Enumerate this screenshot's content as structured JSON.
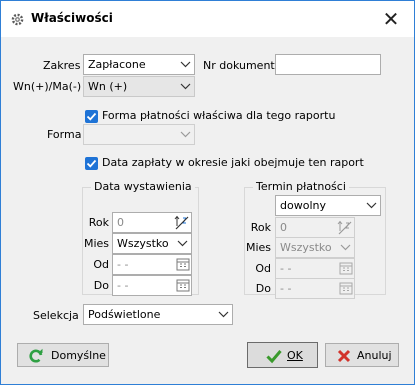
{
  "window": {
    "title": "Właściwości",
    "close_glyph": "✕"
  },
  "top": {
    "zakres_label": "Zakres",
    "zakres_value": "Zapłacone",
    "nr_dokumentu_label": "Nr dokumentu",
    "nr_dokumentu_value": "",
    "wn_ma_label": "Wn(+)/Ma(-)",
    "wn_ma_value": "Wn (+)"
  },
  "forma_platnosci": {
    "checkbox_label": "Forma płatności właściwa dla tego raportu",
    "checked": true,
    "forma_label": "Forma",
    "forma_value": ""
  },
  "data_zaplaty": {
    "checkbox_label": "Data zapłaty w okresie jaki obejmuje ten raport",
    "checked": true
  },
  "data_wystawienia": {
    "title": "Data wystawienia",
    "rok_label": "Rok",
    "rok_value": "0",
    "mies_label": "Mies",
    "mies_value": "Wszystko",
    "od_label": "Od",
    "od_value": "-  -",
    "do_label": "Do",
    "do_value": "-  -"
  },
  "termin_platnosci": {
    "title": "Termin płatności",
    "mode_value": "dowolny",
    "rok_label": "Rok",
    "rok_value": "0",
    "mies_label": "Mies",
    "mies_value": "Wszystko",
    "od_label": "Od",
    "od_value": "-  -",
    "do_label": "Do",
    "do_value": "-  -"
  },
  "selekcja": {
    "label": "Selekcja",
    "value": "Podświetlone"
  },
  "buttons": {
    "domyslne": "Domyślne",
    "ok": "OK",
    "anuluj": "Anuluj"
  },
  "colors": {
    "accent": "#1e73d6",
    "ok_green": "#3a9a2c",
    "cancel_red": "#d2332b",
    "refresh_green": "#2ea043"
  },
  "icons": {
    "title": "gear-icon",
    "close": "close-icon",
    "chevron": "chevron-down-icon",
    "spin": "spin-sort-icon",
    "calendar": "calendar-icon",
    "refresh": "refresh-icon",
    "ok": "checkmark-icon",
    "cancel": "cross-icon"
  }
}
